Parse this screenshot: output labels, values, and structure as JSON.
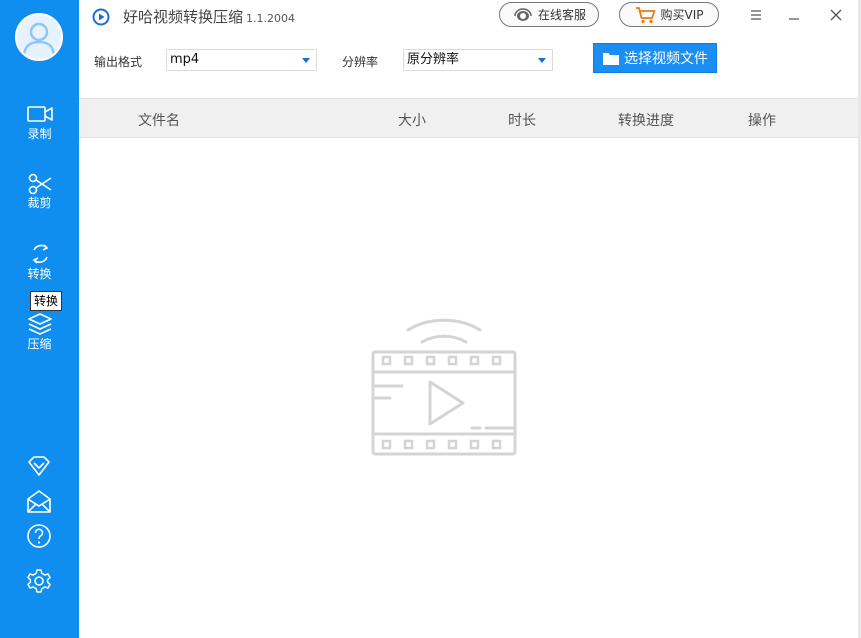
{
  "app": {
    "title": "好哈视频转换压缩",
    "version": "1.1.2004"
  },
  "header": {
    "support_label": "在线客服",
    "vip_label": "购买VIP"
  },
  "sidebar": {
    "items": [
      {
        "label": "录制",
        "icon": "video-camera-icon"
      },
      {
        "label": "裁剪",
        "icon": "scissors-icon"
      },
      {
        "label": "转换",
        "icon": "convert-icon"
      },
      {
        "label": "压缩",
        "icon": "layers-icon"
      }
    ],
    "tooltip": "转换",
    "bottom_icons": [
      "diamond-icon",
      "envelope-icon",
      "help-icon",
      "gear-icon"
    ]
  },
  "toolbar": {
    "format_label": "输出格式",
    "format_value": "mp4",
    "resolution_label": "分辨率",
    "resolution_value": "原分辨率",
    "select_file_label": "选择视频文件"
  },
  "table": {
    "columns": [
      "文件名",
      "大小",
      "时长",
      "转换进度",
      "操作"
    ]
  },
  "colors": {
    "sidebar_bg": "#0f8ef0",
    "primary_button": "#1a8ef2",
    "header_bg": "#f0f0f0"
  }
}
